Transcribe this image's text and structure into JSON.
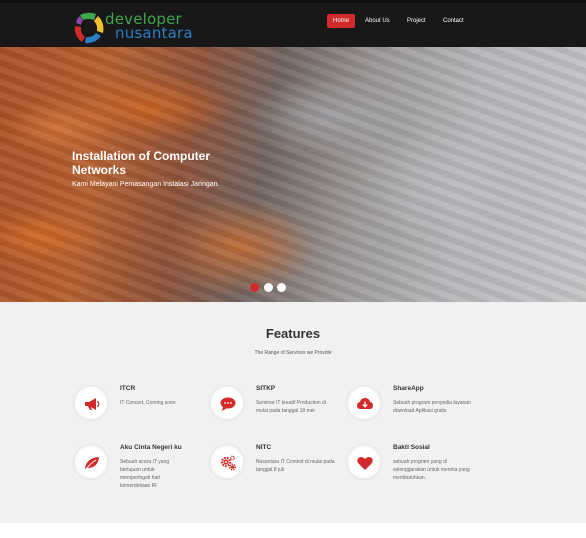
{
  "logo": {
    "line1": "developer",
    "line2": "nusantara"
  },
  "nav": {
    "items": [
      {
        "label": "Home",
        "active": true
      },
      {
        "label": "About Us",
        "active": false
      },
      {
        "label": "Project",
        "active": false
      },
      {
        "label": "Contact",
        "active": false
      }
    ]
  },
  "hero": {
    "title": "Installation of Computer Networks",
    "subtitle": "Kami Melayani Pemasangan Instalasi Jaringan.",
    "slides": 3,
    "active_slide": 1
  },
  "features": {
    "title": "Features",
    "subtitle": "The Range of Services we Provide",
    "items": [
      {
        "title": "ITCR",
        "desc": "IT Concert, Coming soon",
        "icon": "megaphone-icon"
      },
      {
        "title": "SITKP",
        "desc": "Seminar IT kreatif Production di mulai pada tanggal 18 mei",
        "icon": "chat-icon"
      },
      {
        "title": "ShareApp",
        "desc": "Sebuah program penyedia layanan download Aplikasi gratis",
        "icon": "cloud-download-icon"
      },
      {
        "title": "Aku Cinta Negeri ku",
        "desc": "Sebuah acara IT yang bertujuan untuk memperingati hari kemerdekaan RI",
        "icon": "leaf-icon"
      },
      {
        "title": "NITC",
        "desc": "Nusantara IT Contest di mulai pada tanggal 8 juli",
        "icon": "gears-icon"
      },
      {
        "title": "Bakti Sosial",
        "desc": "sebuah program yang di selenggarakan untuk mereka yang membutuhkan.",
        "icon": "heart-icon"
      }
    ]
  },
  "colors": {
    "accent": "#d22a2a",
    "header_bg": "#181818",
    "features_bg": "#f1f1f1"
  }
}
